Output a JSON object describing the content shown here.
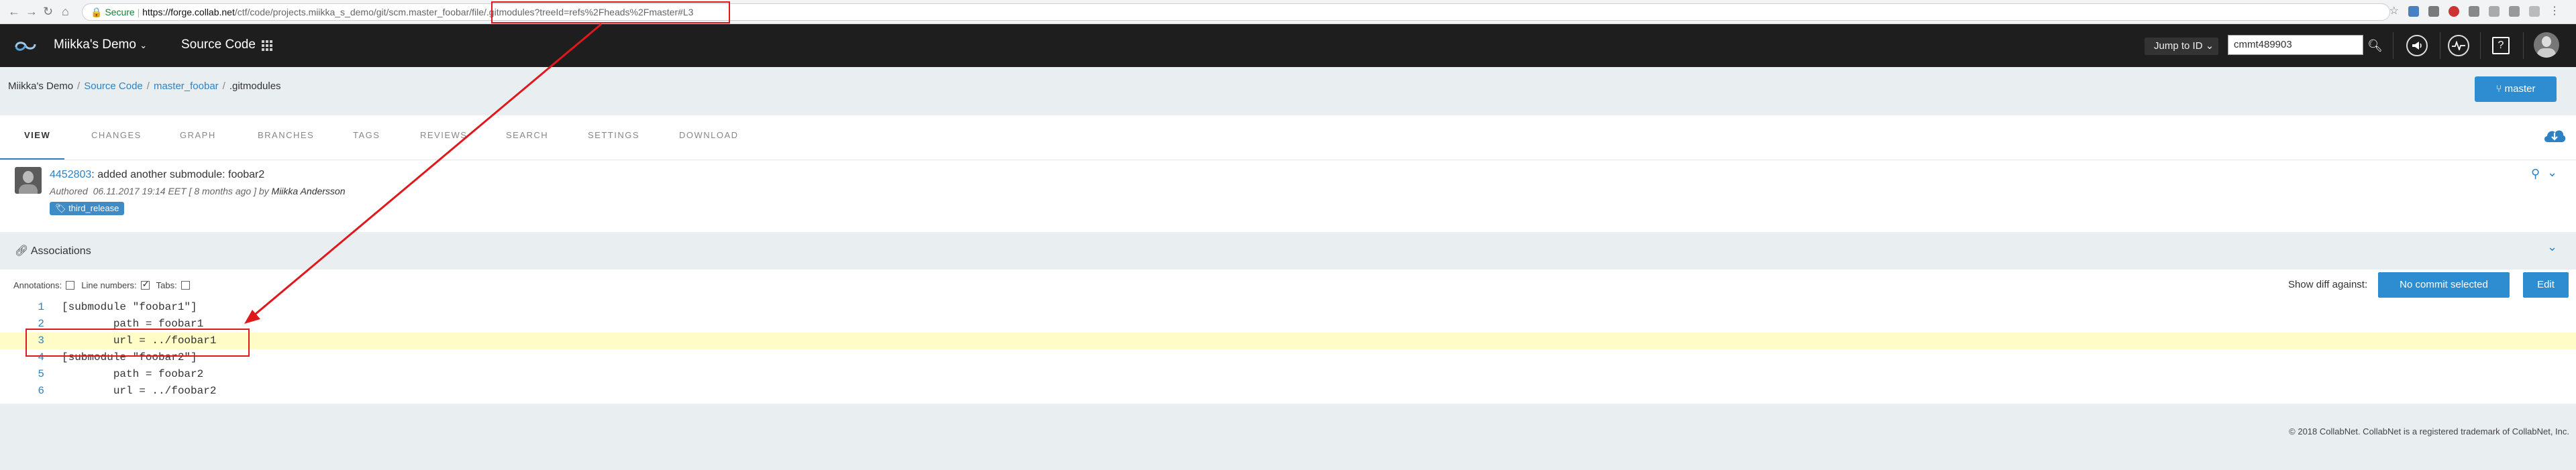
{
  "browser": {
    "secure_label": "Secure",
    "url_host": "https://forge.collab.net",
    "url_path": "/ctf/code/projects.miikka_s_demo/git/scm.master_foobar/file/.gitmodules?treeId=refs%2Fheads%2Fmaster#L3"
  },
  "header": {
    "project": "Miikka's Demo",
    "section": "Source Code",
    "jump_label": "Jump to ID",
    "search_value": "cmmt489903"
  },
  "breadcrumb": {
    "project": "Miikka's Demo",
    "source": "Source Code",
    "repo": "master_foobar",
    "file": ".gitmodules"
  },
  "branch_button": "master",
  "tabs": [
    "VIEW",
    "CHANGES",
    "GRAPH",
    "BRANCHES",
    "TAGS",
    "REVIEWS",
    "SEARCH",
    "SETTINGS",
    "DOWNLOAD"
  ],
  "commit": {
    "id": "4452803",
    "message": ": added another submodule: foobar2",
    "authored_prefix": "Authored",
    "authored_rest": "06.11.2017 19:14 EET [ 8 months ago ] by ",
    "author": "Miikka Andersson",
    "tag": "third_release"
  },
  "associations_title": "Associations",
  "options": {
    "annotations": "Annotations:",
    "line_numbers": "Line numbers:",
    "tabs": "Tabs:"
  },
  "diff": {
    "label": "Show diff against:",
    "button": "No commit selected",
    "edit": "Edit"
  },
  "code_lines": [
    {
      "num": "1",
      "text": "[submodule \"foobar1\"]"
    },
    {
      "num": "2",
      "text": "        path = foobar1"
    },
    {
      "num": "3",
      "text": "        url = ../foobar1"
    },
    {
      "num": "4",
      "text": "[submodule \"foobar2\"]"
    },
    {
      "num": "5",
      "text": "        path = foobar2"
    },
    {
      "num": "6",
      "text": "        url = ../foobar2"
    }
  ],
  "highlighted_line": 3,
  "footer": "© 2018 CollabNet. CollabNet is a registered trademark of CollabNet, Inc.",
  "colors": {
    "accent": "#2e8dd1",
    "annotation_red": "#e0181c",
    "highlight": "#fffcc8"
  }
}
